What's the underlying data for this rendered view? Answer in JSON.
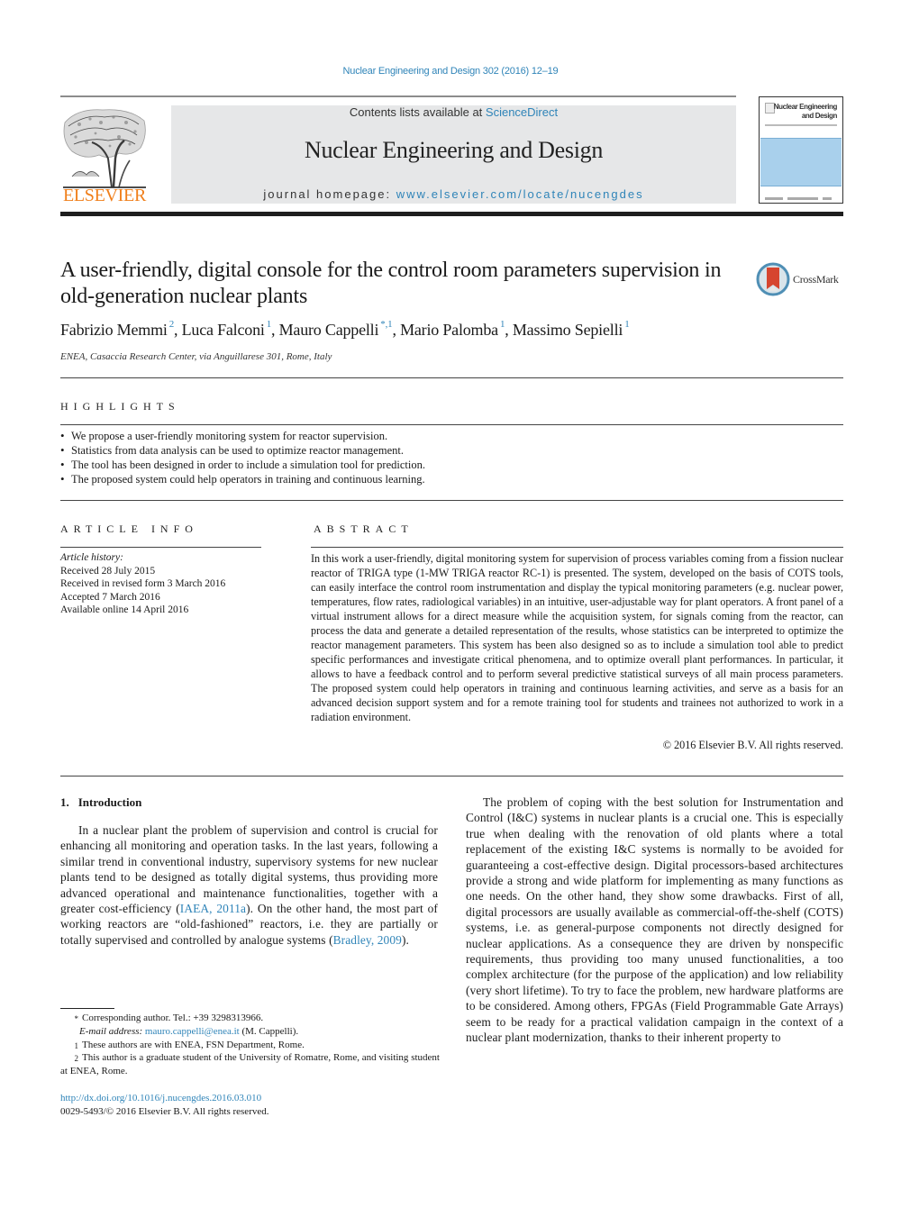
{
  "header": {
    "journal_ref": "Nuclear Engineering and Design 302 (2016) 12–19",
    "contents_prefix": "Contents lists available at ",
    "contents_link": "ScienceDirect",
    "journal_title": "Nuclear Engineering and Design",
    "homepage_prefix": "journal homepage: ",
    "homepage_link": "www.elsevier.com/locate/nucengdes",
    "publisher_logo_text": "ELSEVIER",
    "cover_title_line1": "Nuclear Engineering",
    "cover_title_line2": "and Design",
    "colors": {
      "link": "#2f84b8",
      "elsevier_orange": "#f07f1b",
      "banner_bg": "#e6e7e8",
      "cover_blue": "#a9d0ec"
    }
  },
  "article": {
    "title": "A user-friendly, digital console for the control room parameters supervision in old-generation nuclear plants",
    "crossmark_label": "CrossMark",
    "authors": [
      {
        "name": "Fabrizio Memmi",
        "marks": "2"
      },
      {
        "name": "Luca Falconi",
        "marks": "1"
      },
      {
        "name": "Mauro Cappelli",
        "marks": "*,1"
      },
      {
        "name": "Mario Palomba",
        "marks": "1"
      },
      {
        "name": "Massimo Sepielli",
        "marks": "1"
      }
    ],
    "affiliation": "ENEA, Casaccia Research Center, via Anguillarese 301, Rome, Italy"
  },
  "highlights": {
    "heading": "HIGHLIGHTS",
    "items": [
      "We propose a user-friendly monitoring system for reactor supervision.",
      "Statistics from data analysis can be used to optimize reactor management.",
      "The tool has been designed in order to include a simulation tool for prediction.",
      "The proposed system could help operators in training and continuous learning."
    ]
  },
  "article_info": {
    "heading": "ARTICLE INFO",
    "history_label": "Article history:",
    "received": "Received 28 July 2015",
    "revised": "Received in revised form 3 March 2016",
    "accepted": "Accepted 7 March 2016",
    "online": "Available online 14 April 2016"
  },
  "abstract": {
    "heading": "ABSTRACT",
    "text": "In this work a user-friendly, digital monitoring system for supervision of process variables coming from a fission nuclear reactor of TRIGA type (1-MW TRIGA reactor RC-1) is presented. The system, developed on the basis of COTS tools, can easily interface the control room instrumentation and display the typical monitoring parameters (e.g. nuclear power, temperatures, flow rates, radiological variables) in an intuitive, user-adjustable way for plant operators. A front panel of a virtual instrument allows for a direct measure while the acquisition system, for signals coming from the reactor, can process the data and generate a detailed representation of the results, whose statistics can be interpreted to optimize the reactor management parameters. This system has been also designed so as to include a simulation tool able to predict specific performances and investigate critical phenomena, and to optimize overall plant performances. In particular, it allows to have a feedback control and to perform several predictive statistical surveys of all main process parameters. The proposed system could help operators in training and continuous learning activities, and serve as a basis for an advanced decision support system and for a remote training tool for students and trainees not authorized to work in a radiation environment.",
    "copyright": "© 2016 Elsevier B.V. All rights reserved."
  },
  "body": {
    "section_number": "1.",
    "section_title": "Introduction",
    "intro_p1_a": "In a nuclear plant the problem of supervision and control is crucial for enhancing all monitoring and operation tasks. In the last years, following a similar trend in conventional industry, supervisory systems for new nuclear plants tend to be designed as totally digital systems, thus providing more advanced operational and maintenance functionalities, together with a greater cost-efficiency (",
    "intro_cite1": "IAEA, 2011a",
    "intro_p1_b": "). On the other hand, the most part of working reactors are “old-fashioned” reactors, i.e. they are partially or totally supervised and controlled by analogue systems (",
    "intro_cite2": "Bradley, 2009",
    "intro_p1_c": ").",
    "col2_p1": "The problem of coping with the best solution for Instrumentation and Control (I&C) systems in nuclear plants is a crucial one. This is especially true when dealing with the renovation of old plants where a total replacement of the existing I&C systems is normally to be avoided for guaranteeing a cost-effective design. Digital processors-based architectures provide a strong and wide platform for implementing as many functions as one needs. On the other hand, they show some drawbacks. First of all, digital processors are usually available as commercial-off-the-shelf (COTS) systems, i.e. as general-purpose components not directly designed for nuclear applications. As a consequence they are driven by nonspecific requirements, thus providing too many unused functionalities, a too complex architecture (for the purpose of the application) and low reliability (very short lifetime). To try to face the problem, new hardware platforms are to be considered. Among others, FPGAs (Field Programmable Gate Arrays) seem to be ready for a practical validation campaign in the context of a nuclear plant modernization, thanks to their inherent property to"
  },
  "footnotes": {
    "corr_mark": "*",
    "corr_text": "Corresponding author. Tel.: +39 3298313966.",
    "email_label": "E-mail address:",
    "email": "mauro.cappelli@enea.it",
    "email_suffix": " (M. Cappelli).",
    "fn1_mark": "1",
    "fn1_text": "These authors are with ENEA, FSN Department, Rome.",
    "fn2_mark": "2",
    "fn2_text": "This author is a graduate student of the University of Romatre, Rome, and visiting student at ENEA, Rome.",
    "doi_link": "http://dx.doi.org/10.1016/j.nucengdes.2016.03.010",
    "issn_line": "0029-5493/© 2016 Elsevier B.V. All rights reserved."
  }
}
